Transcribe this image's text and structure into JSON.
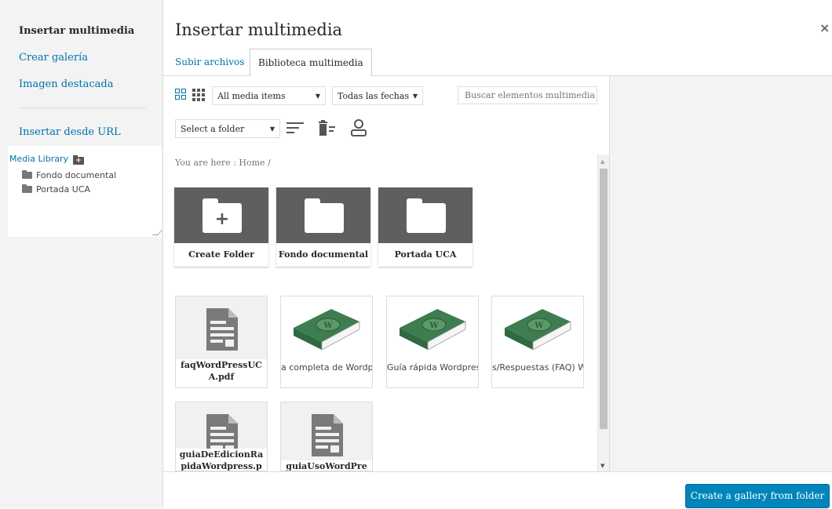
{
  "sidebar": {
    "items": [
      {
        "label": "Insertar multimedia",
        "active": true
      },
      {
        "label": "Crear galería",
        "active": false
      },
      {
        "label": "Imagen destacada",
        "active": false
      },
      {
        "label": "Insertar desde URL",
        "active": false
      }
    ],
    "tree": {
      "root": "Media Library",
      "folders": [
        "Fondo documental",
        "Portada UCA"
      ]
    }
  },
  "modal": {
    "title": "Insertar multimedia",
    "close": "×",
    "tabs": [
      {
        "label": "Subir archivos"
      },
      {
        "label": "Biblioteca multimedia"
      }
    ]
  },
  "filters": {
    "type_select": "All media items",
    "date_select": "Todas las fechas",
    "search_placeholder": "Buscar elementos multimedia",
    "folder_select": "Select a folder"
  },
  "breadcrumb": {
    "prefix": "You are here :",
    "home": "Home",
    "sep": "/"
  },
  "folders": [
    {
      "label": "Create Folder",
      "icon": "folder-plus-icon"
    },
    {
      "label": "Fondo documental",
      "icon": "folder-icon"
    },
    {
      "label": "Portada UCA",
      "icon": "folder-icon"
    }
  ],
  "attachments": [
    {
      "kind": "document",
      "line1": "faqWordPressUC",
      "line2": "A.pdf"
    },
    {
      "kind": "book",
      "title": "a completa de Wordp"
    },
    {
      "kind": "book",
      "title": "Guía rápida Wordpres"
    },
    {
      "kind": "book",
      "title": "s/Respuestas (FAQ) W"
    },
    {
      "kind": "document",
      "line1": "guiaDeEdicionRa",
      "line2": "pidaWordpress.p"
    },
    {
      "kind": "document",
      "line1": "guiaUsoWordPre",
      "line2": ""
    }
  ],
  "footer": {
    "button": "Create a gallery from folder"
  },
  "colors": {
    "accent": "#0073aa",
    "primary_button": "#0085ba",
    "folder_tile": "#5f5f5f",
    "book_green": "#3e7d50"
  }
}
